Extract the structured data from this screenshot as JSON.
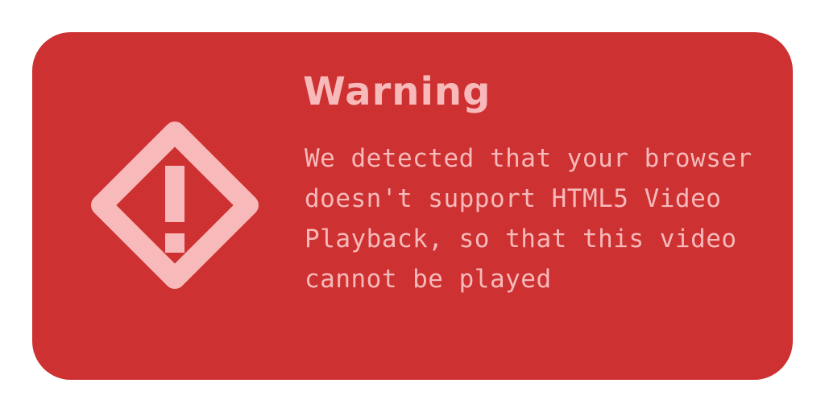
{
  "dialog": {
    "icon": "warning-diamond-icon",
    "title": "Warning",
    "message": "We detected that your browser doesn't support HTML5 Video Playback, so that this video cannot be played"
  },
  "colors": {
    "background": "#ffffff",
    "card": "#cd3131",
    "foreground": "#f7b9ba"
  }
}
